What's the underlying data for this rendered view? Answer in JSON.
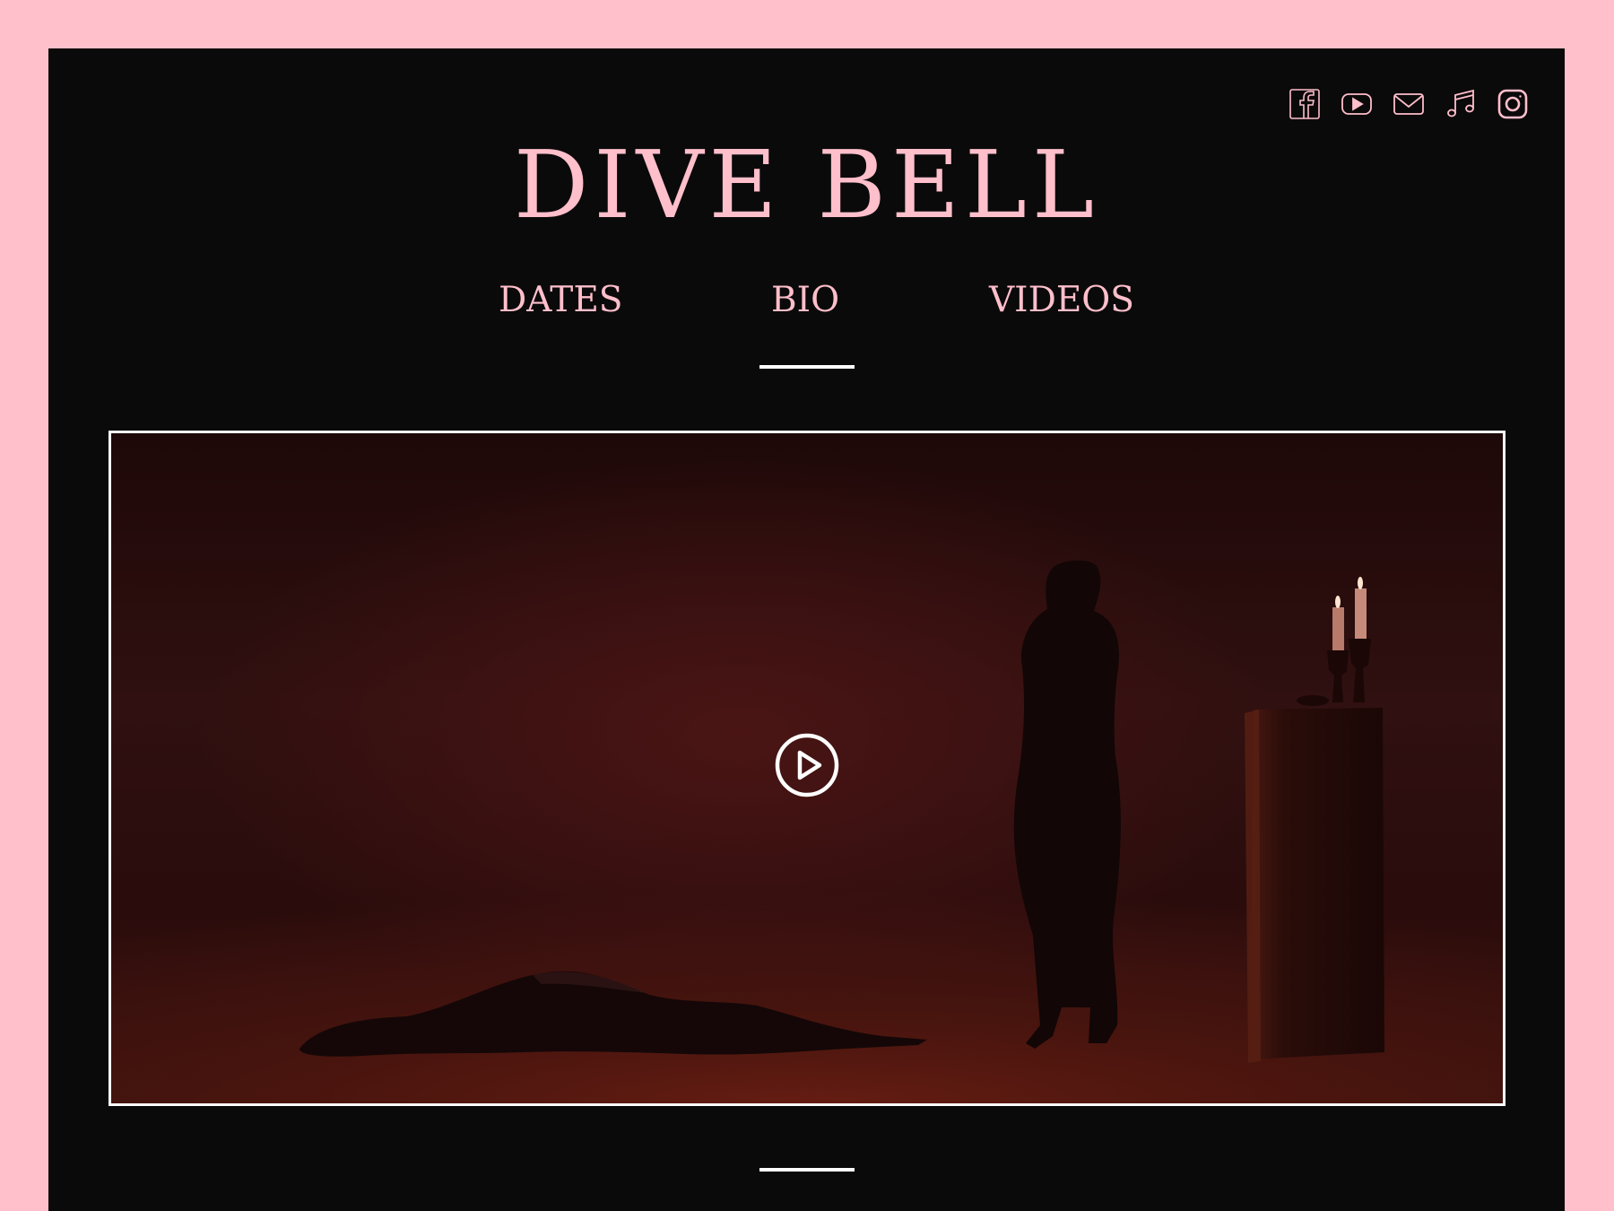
{
  "header": {
    "title": "DIVE BELL",
    "nav": [
      {
        "label": "DATES"
      },
      {
        "label": "BIO"
      },
      {
        "label": "VIDEOS"
      }
    ]
  },
  "social": {
    "icons": [
      "facebook-icon",
      "youtube-icon",
      "email-icon",
      "music-icon",
      "instagram-icon"
    ]
  },
  "colors": {
    "background_outer": "#ffbfcb",
    "background_page": "#0b0a0b",
    "accent": "#ffbfcb",
    "divider": "#ffffff",
    "video_tint": "#3a110c"
  },
  "video": {
    "play_icon": "play-circle-icon"
  }
}
